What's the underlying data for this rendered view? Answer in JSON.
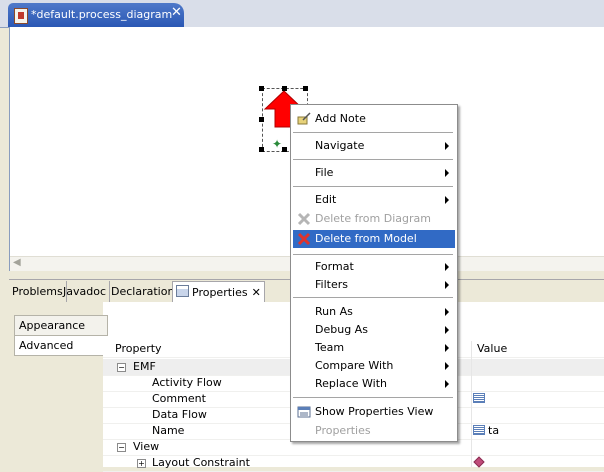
{
  "editor": {
    "tab_title": "*default.process_diagram"
  },
  "views": {
    "tabs": [
      "Problems",
      "Javadoc",
      "Declaration",
      "Properties"
    ],
    "close_glyph": "✕"
  },
  "properties": {
    "side_tabs": [
      "Appearance",
      "Advanced"
    ],
    "columns": {
      "property": "Property",
      "value": "Value"
    },
    "groups": [
      {
        "name": "EMF",
        "rows": [
          {
            "name": "Activity Flow",
            "value": ""
          },
          {
            "name": "Comment",
            "value": ""
          },
          {
            "name": "Data Flow",
            "value": ""
          },
          {
            "name": "Name",
            "value": "ta"
          }
        ]
      },
      {
        "name": "View",
        "rows": [
          {
            "name": "Layout Constraint",
            "value": ""
          }
        ]
      }
    ]
  },
  "context_menu": {
    "add_note": "Add Note",
    "navigate": "Navigate",
    "file": "File",
    "edit": "Edit",
    "delete_from_diagram": "Delete from Diagram",
    "delete_from_model": "Delete from Model",
    "format": "Format",
    "filters": "Filters",
    "run_as": "Run As",
    "debug_as": "Debug As",
    "team": "Team",
    "compare_with": "Compare With",
    "replace_with": "Replace With",
    "show_properties_view": "Show Properties View",
    "properties": "Properties"
  },
  "colors": {
    "selection": "#316ac5",
    "tab_active": "#2a57b4",
    "shape": "#ff0000"
  }
}
